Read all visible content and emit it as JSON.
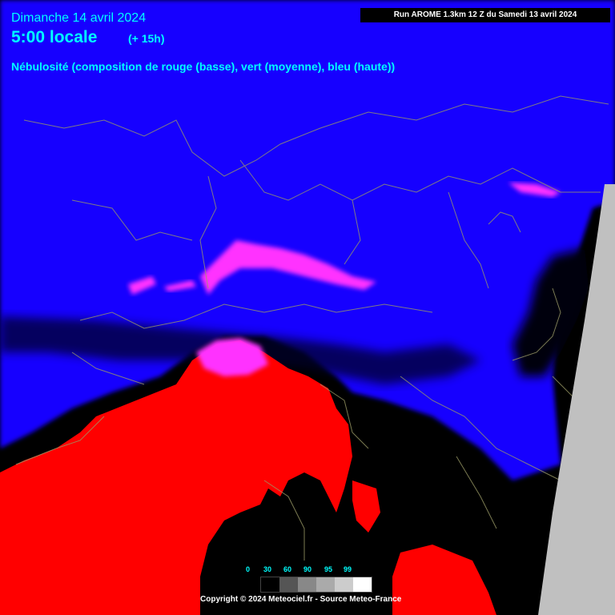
{
  "header": {
    "date": "Dimanche 14 avril 2024",
    "time": "5:00 locale",
    "lead": "(+ 15h)",
    "description": "Nébulosité (composition de rouge (basse), vert (moyenne), bleu (haute))"
  },
  "run_info": "Run AROME 1.3km 12 Z du Samedi 13 avril 2024",
  "legend": {
    "ticks": [
      "0",
      "30",
      "60",
      "90",
      "95",
      "99"
    ],
    "swatch_colors": [
      "#000000",
      "#555555",
      "#888888",
      "#aaaaaa",
      "#cccccc",
      "#ffffff"
    ]
  },
  "copyright": "Copyright © 2024 Meteociel.fr - Source Meteo-France",
  "colors": {
    "high_cloud": "#1400ff",
    "low_cloud": "#ff0000",
    "mixed_cloud": "#ff33ff",
    "clear": "#000000",
    "out_of_domain": "#c0c0c0",
    "text_accent": "#00ffff"
  }
}
